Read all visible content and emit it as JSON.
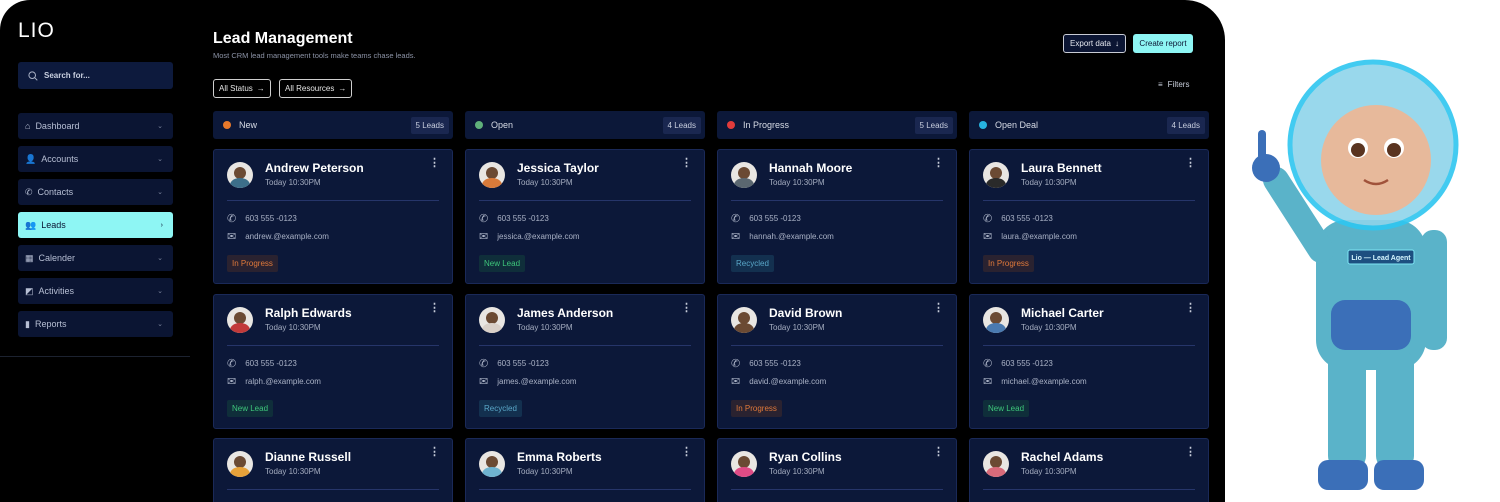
{
  "sidebar": {
    "logo": "LIO",
    "search_placeholder": "Search for...",
    "items": [
      {
        "label": "Dashboard",
        "icon": "home-icon",
        "glyph": "⌂"
      },
      {
        "label": "Accounts",
        "icon": "user-icon",
        "glyph": "👤"
      },
      {
        "label": "Contacts",
        "icon": "phone-icon",
        "glyph": "✆"
      },
      {
        "label": "Leads",
        "icon": "leads-icon",
        "glyph": "👥",
        "active": true
      },
      {
        "label": "Calender",
        "icon": "calendar-icon",
        "glyph": "▦"
      },
      {
        "label": "Activities",
        "icon": "activities-icon",
        "glyph": "◩"
      },
      {
        "label": "Reports",
        "icon": "reports-icon",
        "glyph": "▮"
      }
    ]
  },
  "header": {
    "title": "Lead Management",
    "subtitle": "Most CRM lead management tools make teams chase leads.",
    "export_label": "Export data",
    "create_label": "Create report",
    "filter_status": "All Status",
    "filter_resources": "All Resources",
    "filters_label": "Filters"
  },
  "colors": {
    "accent": "#8ef6f4",
    "card": "#0c1839"
  },
  "columns": [
    {
      "title": "New",
      "count": "5 Leads",
      "dot": "#e8792b",
      "cards": [
        {
          "name": "Andrew Peterson",
          "time": "Today 10:30PM",
          "phone": "603 555 -0123",
          "email": "andrew.@example.com",
          "status": "In Progress"
        },
        {
          "name": "Ralph Edwards",
          "time": "Today 10:30PM",
          "phone": "603 555 -0123",
          "email": "ralph.@example.com",
          "status": "New Lead"
        },
        {
          "name": "Dianne Russell",
          "time": "Today 10:30PM"
        }
      ]
    },
    {
      "title": "Open",
      "count": "4 Leads",
      "dot": "#5fb07a",
      "cards": [
        {
          "name": "Jessica Taylor",
          "time": "Today 10:30PM",
          "phone": "603 555 -0123",
          "email": "jessica.@example.com",
          "status": "New Lead"
        },
        {
          "name": "James Anderson",
          "time": "Today 10:30PM",
          "phone": "603 555 -0123",
          "email": "james.@example.com",
          "status": "Recycled"
        },
        {
          "name": "Emma Roberts",
          "time": "Today 10:30PM"
        }
      ]
    },
    {
      "title": "In Progress",
      "count": "5 Leads",
      "dot": "#e23b3b",
      "cards": [
        {
          "name": "Hannah Moore",
          "time": "Today 10:30PM",
          "phone": "603 555 -0123",
          "email": "hannah.@example.com",
          "status": "Recycled"
        },
        {
          "name": "David Brown",
          "time": "Today 10:30PM",
          "phone": "603 555 -0123",
          "email": "david.@example.com",
          "status": "In Progress"
        },
        {
          "name": "Ryan Collins",
          "time": "Today 10:30PM"
        }
      ]
    },
    {
      "title": "Open Deal",
      "count": "4 Leads",
      "dot": "#27b3e0",
      "cards": [
        {
          "name": "Laura Bennett",
          "time": "Today 10:30PM",
          "phone": "603 555 -0123",
          "email": "laura.@example.com",
          "status": "In Progress"
        },
        {
          "name": "Michael Carter",
          "time": "Today 10:30PM",
          "phone": "603 555 -0123",
          "email": "michael.@example.com",
          "status": "New Lead"
        },
        {
          "name": "Rachel Adams",
          "time": "Today 10:30PM"
        }
      ]
    }
  ],
  "mascot": {
    "badge": "Lio — Lead Agent"
  }
}
